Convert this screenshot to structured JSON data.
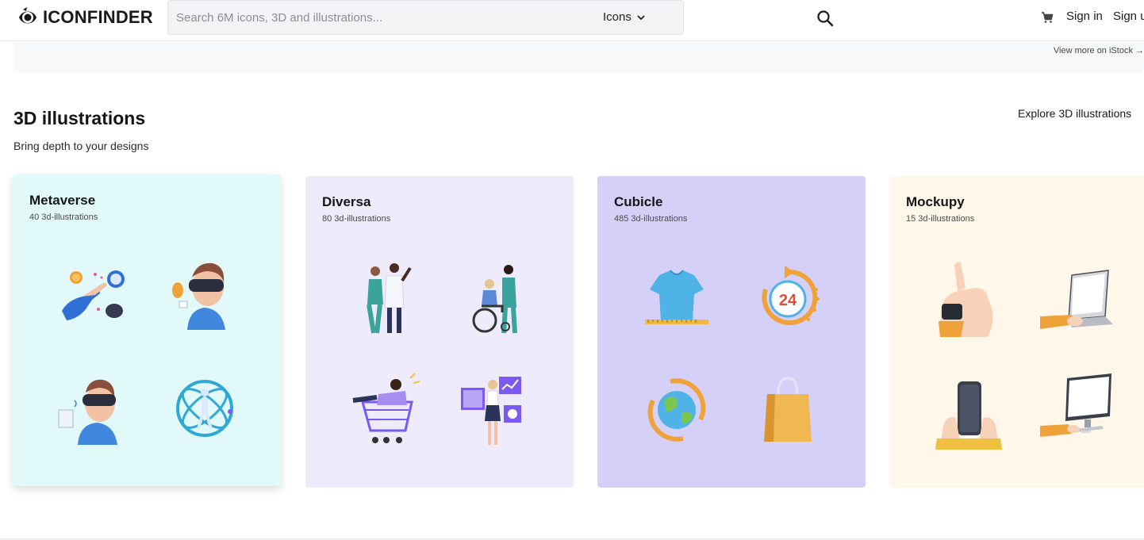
{
  "header": {
    "logo_text": "ICONFINDER",
    "search_placeholder": "Search 6M icons, 3D and illustrations...",
    "search_type": "Icons",
    "sign_in": "Sign in",
    "sign_up": "Sign up"
  },
  "istock": {
    "link": "View more on iStock →"
  },
  "section": {
    "title": "3D illustrations",
    "subtitle": "Bring depth to your designs",
    "explore": "Explore 3D illustrations"
  },
  "cards": [
    {
      "title": "Metaverse",
      "count": "40 3d-illustrations",
      "bg": "#e1f9f9"
    },
    {
      "title": "Diversa",
      "count": "80 3d-illustrations",
      "bg": "#eeebfb"
    },
    {
      "title": "Cubicle",
      "count": "485 3d-illustrations",
      "bg": "#d5d0f8"
    },
    {
      "title": "Mockupy",
      "count": "15 3d-illustrations",
      "bg": "#fff8ea"
    }
  ],
  "cubicle_clock_label": "24"
}
